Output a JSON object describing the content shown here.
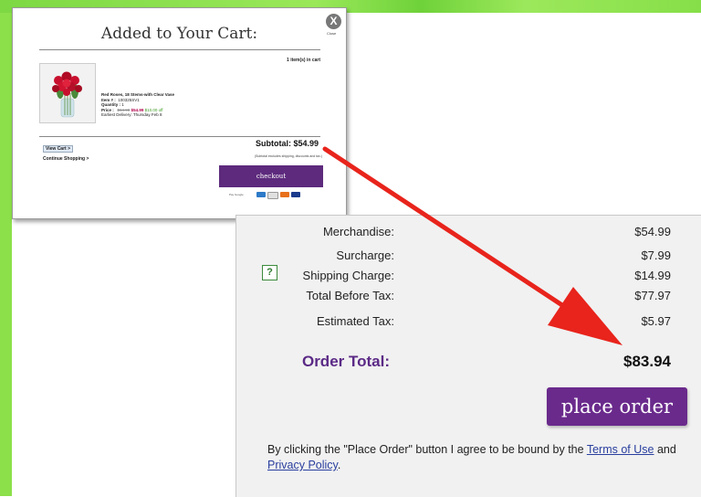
{
  "popup": {
    "title": "Added to Your Cart:",
    "close_glyph": "X",
    "close_label": "Close",
    "items_count": "1 item(s) in cart",
    "product": {
      "name": "Red Roses, 18 Stems-with Clear Vase",
      "item_label": "Item # :",
      "item_number": "100325SV1",
      "quantity_label": "Quantity :",
      "quantity": "1",
      "price_label": "Price :",
      "original_price": "$64.99",
      "sale_price": "$54.99",
      "discount": "$10.00 off",
      "delivery": "Earliest Delivery: Thursday Feb 8"
    },
    "view_cart": "View Cart >",
    "continue_shopping": "Continue Shopping >",
    "subtotal": "Subtotal:  $54.99",
    "subtotal_note": "(Subtotal excludes shipping, discounts and tax.)",
    "checkout": "checkout",
    "pay_label": "Pay Google"
  },
  "summary": {
    "rows": [
      {
        "label": "Merchandise:",
        "value": "$54.99"
      },
      {
        "label": "Surcharge:",
        "value": "$7.99"
      },
      {
        "label": "Shipping Charge:",
        "value": "$14.99"
      },
      {
        "label": "Total Before Tax:",
        "value": "$77.97"
      },
      {
        "label": "Estimated Tax:",
        "value": "$5.97"
      }
    ],
    "help_icon": "?",
    "order_total_label": "Order Total:",
    "order_total_value": "$83.94",
    "place_order": "place order",
    "legal_prefix": "By clicking the \"Place Order\" button I agree to be bound by the ",
    "terms_link": "Terms of Use",
    "legal_and": " and ",
    "privacy_link": "Privacy Policy",
    "legal_suffix": "."
  },
  "icons": {
    "close": "close-icon",
    "help": "help-icon",
    "arrow": "red-arrow-annotation"
  },
  "colors": {
    "accent_purple": "#6a2a8c",
    "total_label": "#5b2a86",
    "arrow": "#e8241c",
    "frame_green": "#8ce04a",
    "sale_price": "#b0004c"
  }
}
